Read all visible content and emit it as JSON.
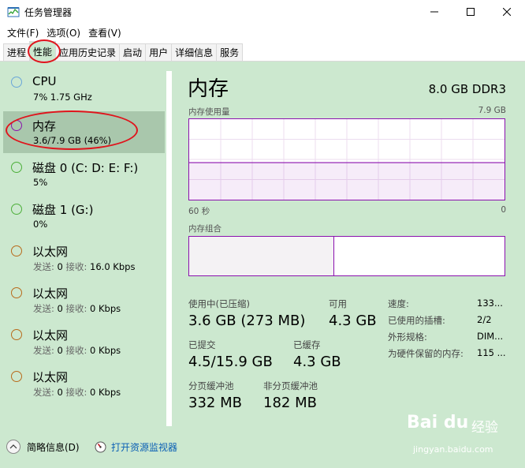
{
  "window": {
    "title": "任务管理器"
  },
  "menu": [
    "文件(F)",
    "选项(O)",
    "查看(V)"
  ],
  "tabs": [
    "进程",
    "性能",
    "应用历史记录",
    "启动",
    "用户",
    "详细信息",
    "服务"
  ],
  "active_tab": 1,
  "sidebar": {
    "items": [
      {
        "title": "CPU",
        "sub": "7% 1.75 GHz",
        "ring": "#6aa6d9"
      },
      {
        "title": "内存",
        "sub": "3.6/7.9 GB (46%)",
        "ring": "#8b12ae",
        "selected": true
      },
      {
        "title": "磁盘 0 (C: D: E: F:)",
        "sub": "5%",
        "ring": "#4caf3a"
      },
      {
        "title": "磁盘 1 (G:)",
        "sub": "0%",
        "ring": "#4caf3a"
      },
      {
        "title": "以太网",
        "send_label": "发送:",
        "send": "0",
        "recv_label": "接收:",
        "recv": "16.0 Kbps",
        "ring": "#b86b1c"
      },
      {
        "title": "以太网",
        "send_label": "发送:",
        "send": "0",
        "recv_label": "接收:",
        "recv": "0 Kbps",
        "ring": "#b86b1c"
      },
      {
        "title": "以太网",
        "send_label": "发送:",
        "send": "0",
        "recv_label": "接收:",
        "recv": "0 Kbps",
        "ring": "#b86b1c"
      },
      {
        "title": "以太网",
        "send_label": "发送:",
        "send": "0",
        "recv_label": "接收:",
        "recv": "0 Kbps",
        "ring": "#b86b1c"
      }
    ]
  },
  "main": {
    "title": "内存",
    "spec": "8.0 GB DDR3",
    "usage_label": "内存使用量",
    "usage_max": "7.9 GB",
    "time_left": "60 秒",
    "time_right": "0",
    "usage_fraction": 0.46,
    "composition_label": "内存组合",
    "composition_fraction": 0.46,
    "stats": {
      "in_use_label": "使用中(已压缩)",
      "in_use": "3.6 GB (273 MB)",
      "available_label": "可用",
      "available": "4.3 GB",
      "committed_label": "已提交",
      "committed": "4.5/15.9 GB",
      "cached_label": "已缓存",
      "cached": "4.3 GB",
      "paged_label": "分页缓冲池",
      "paged": "332 MB",
      "nonpaged_label": "非分页缓冲池",
      "nonpaged": "182 MB"
    },
    "kv": [
      {
        "label": "速度:",
        "value": "133..."
      },
      {
        "label": "已使用的插槽:",
        "value": "2/2"
      },
      {
        "label": "外形规格:",
        "value": "DIM..."
      },
      {
        "label": "为硬件保留的内存:",
        "value": "115 ..."
      }
    ]
  },
  "footer": {
    "summary": "简略信息(D)",
    "resmon": "打开资源监视器"
  },
  "watermark": {
    "logo": "Bai du",
    "text": "经验",
    "url": "jingyan.baidu.com"
  },
  "accent": "#8b12ae"
}
